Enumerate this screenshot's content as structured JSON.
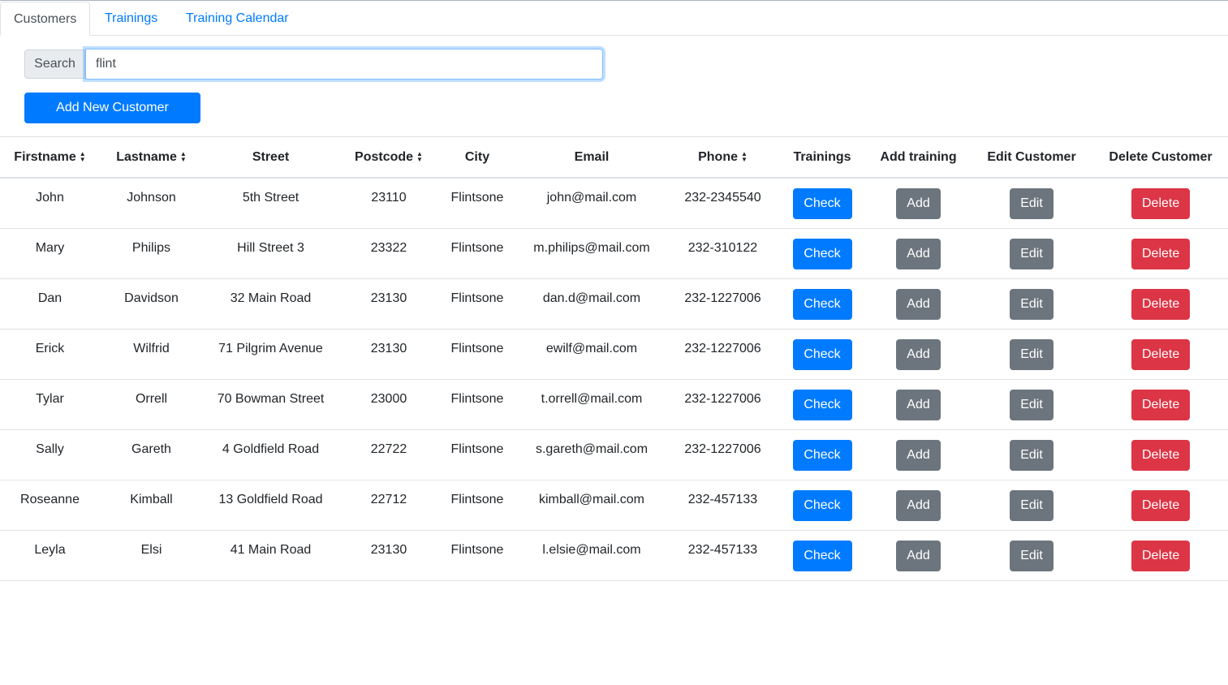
{
  "tabs": [
    "Customers",
    "Trainings",
    "Training Calendar"
  ],
  "search": {
    "label": "Search",
    "value": "flint"
  },
  "add_customer_label": "Add New Customer",
  "columns": [
    "Firstname",
    "Lastname",
    "Street",
    "Postcode",
    "City",
    "Email",
    "Phone",
    "Trainings",
    "Add training",
    "Edit Customer",
    "Delete Customer"
  ],
  "sortable_columns": [
    "Firstname",
    "Lastname",
    "Postcode",
    "Phone"
  ],
  "buttons": {
    "check": "Check",
    "add": "Add",
    "edit": "Edit",
    "delete": "Delete"
  },
  "rows": [
    {
      "firstname": "John",
      "lastname": "Johnson",
      "street": "5th Street",
      "postcode": "23110",
      "city": "Flintsone",
      "email": "john@mail.com",
      "phone": "232-2345540"
    },
    {
      "firstname": "Mary",
      "lastname": "Philips",
      "street": "Hill Street 3",
      "postcode": "23322",
      "city": "Flintsone",
      "email": "m.philips@mail.com",
      "phone": "232-310122"
    },
    {
      "firstname": "Dan",
      "lastname": "Davidson",
      "street": "32 Main Road",
      "postcode": "23130",
      "city": "Flintsone",
      "email": "dan.d@mail.com",
      "phone": "232-1227006"
    },
    {
      "firstname": "Erick",
      "lastname": "Wilfrid",
      "street": "71 Pilgrim Avenue",
      "postcode": "23130",
      "city": "Flintsone",
      "email": "ewilf@mail.com",
      "phone": "232-1227006"
    },
    {
      "firstname": "Tylar",
      "lastname": "Orrell",
      "street": "70 Bowman Street",
      "postcode": "23000",
      "city": "Flintsone",
      "email": "t.orrell@mail.com",
      "phone": "232-1227006"
    },
    {
      "firstname": "Sally",
      "lastname": "Gareth",
      "street": "4 Goldfield Road",
      "postcode": "22722",
      "city": "Flintsone",
      "email": "s.gareth@mail.com",
      "phone": "232-1227006"
    },
    {
      "firstname": "Roseanne",
      "lastname": "Kimball",
      "street": "13 Goldfield Road",
      "postcode": "22712",
      "city": "Flintsone",
      "email": "kimball@mail.com",
      "phone": "232-457133"
    },
    {
      "firstname": "Leyla",
      "lastname": "Elsi",
      "street": "41 Main Road",
      "postcode": "23130",
      "city": "Flintsone",
      "email": "l.elsie@mail.com",
      "phone": "232-457133"
    }
  ],
  "colors": {
    "primary": "#007bff",
    "secondary": "#6c757d",
    "danger": "#dc3545"
  }
}
